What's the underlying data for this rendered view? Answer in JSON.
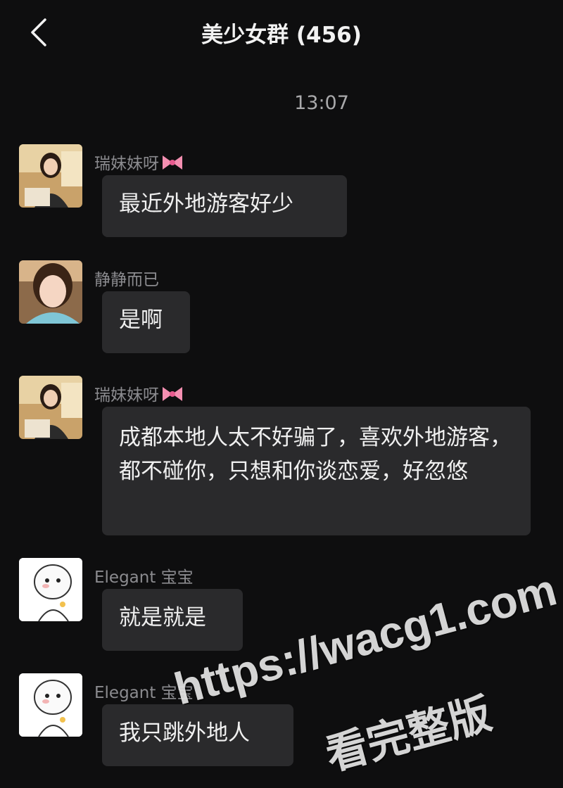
{
  "header": {
    "title": "美少女群 (456)"
  },
  "time_label": "13:07",
  "messages": [
    {
      "sender": "瑞妹妹呀",
      "text": "最近外地游客好少"
    },
    {
      "sender": "静静而已",
      "text": "是啊"
    },
    {
      "sender": "瑞妹妹呀",
      "text": "成都本地人太不好骗了，喜欢外地游客，都不碰你，只想和你谈恋爱，好忽悠"
    },
    {
      "sender": "Elegant 宝宝",
      "text": "就是就是"
    },
    {
      "sender": "Elegant 宝宝",
      "text": "我只跳外地人"
    }
  ],
  "watermark": {
    "url": "https://wacg1.com",
    "caption": "看完整版"
  },
  "icons": {
    "back": "back-arrow-icon",
    "bow": "pink-bow-icon"
  },
  "colors": {
    "background": "#0e0e0f",
    "bubble": "#2a2a2c",
    "name": "#8b8b8f",
    "bow": "#f48fb1"
  }
}
